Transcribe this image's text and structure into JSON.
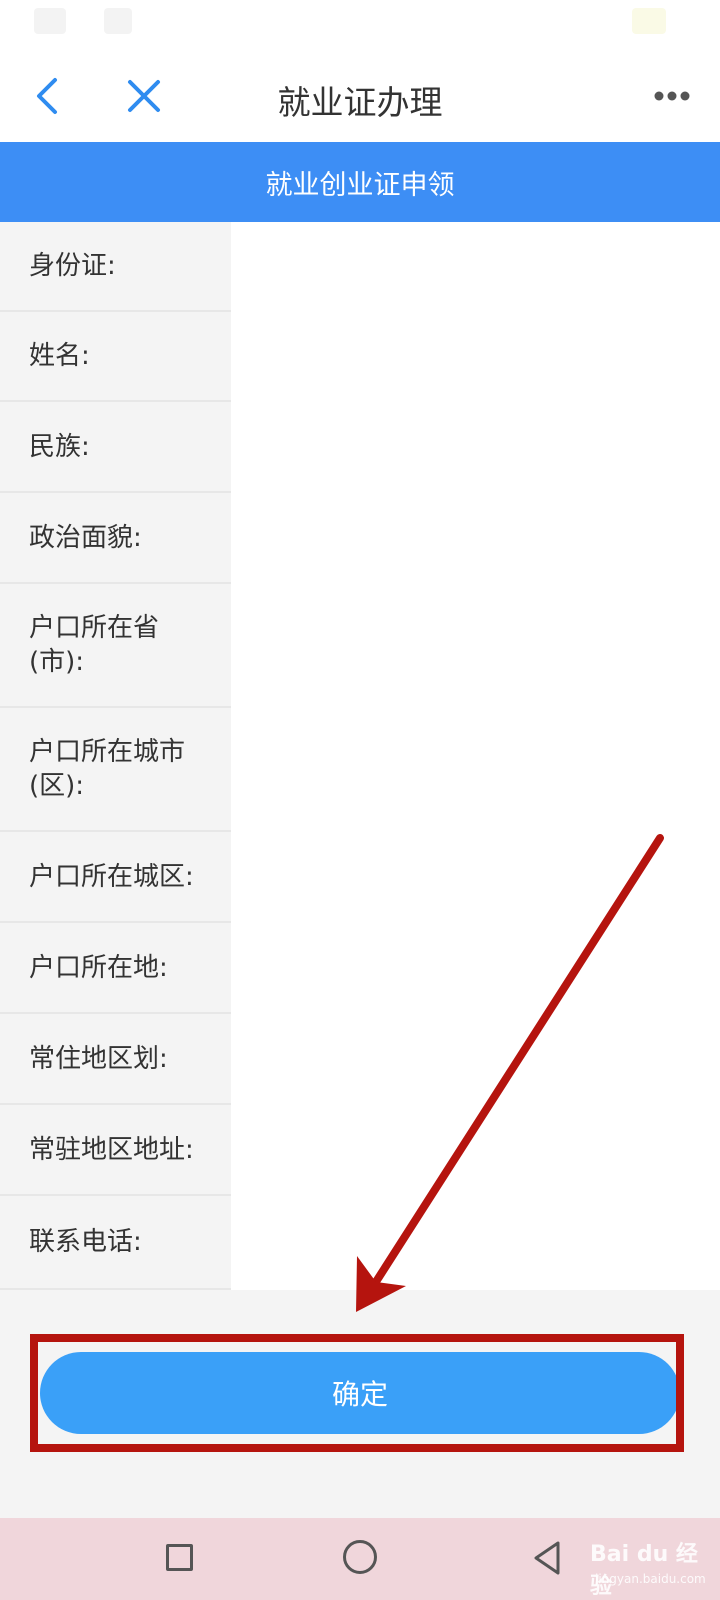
{
  "header": {
    "title": "就业证办理",
    "back_icon": "chevron-left-icon",
    "close_icon": "close-icon",
    "more_icon": "more-icon"
  },
  "banner": {
    "text": "就业创业证申领"
  },
  "form": {
    "fields": [
      {
        "label": "身份证:",
        "value": ""
      },
      {
        "label": "姓名:",
        "value": ""
      },
      {
        "label": "民族:",
        "value": ""
      },
      {
        "label": "政治面貌:",
        "value": ""
      },
      {
        "label": "户口所在省(市):",
        "value": ""
      },
      {
        "label": "户口所在城市(区):",
        "value": ""
      },
      {
        "label": "户口所在城区:",
        "value": ""
      },
      {
        "label": "户口所在地:",
        "value": ""
      },
      {
        "label": "常住地区划:",
        "value": ""
      },
      {
        "label": "常驻地区地址:",
        "value": ""
      },
      {
        "label": "联系电话:",
        "value": ""
      }
    ]
  },
  "confirm": {
    "label": "确定"
  },
  "colors": {
    "accent": "#3d8ef5",
    "button": "#3aa0f8",
    "annotation": "#b5140e"
  },
  "watermark": {
    "main": "Bai du 经验",
    "sub": "jingyan.baidu.com"
  }
}
